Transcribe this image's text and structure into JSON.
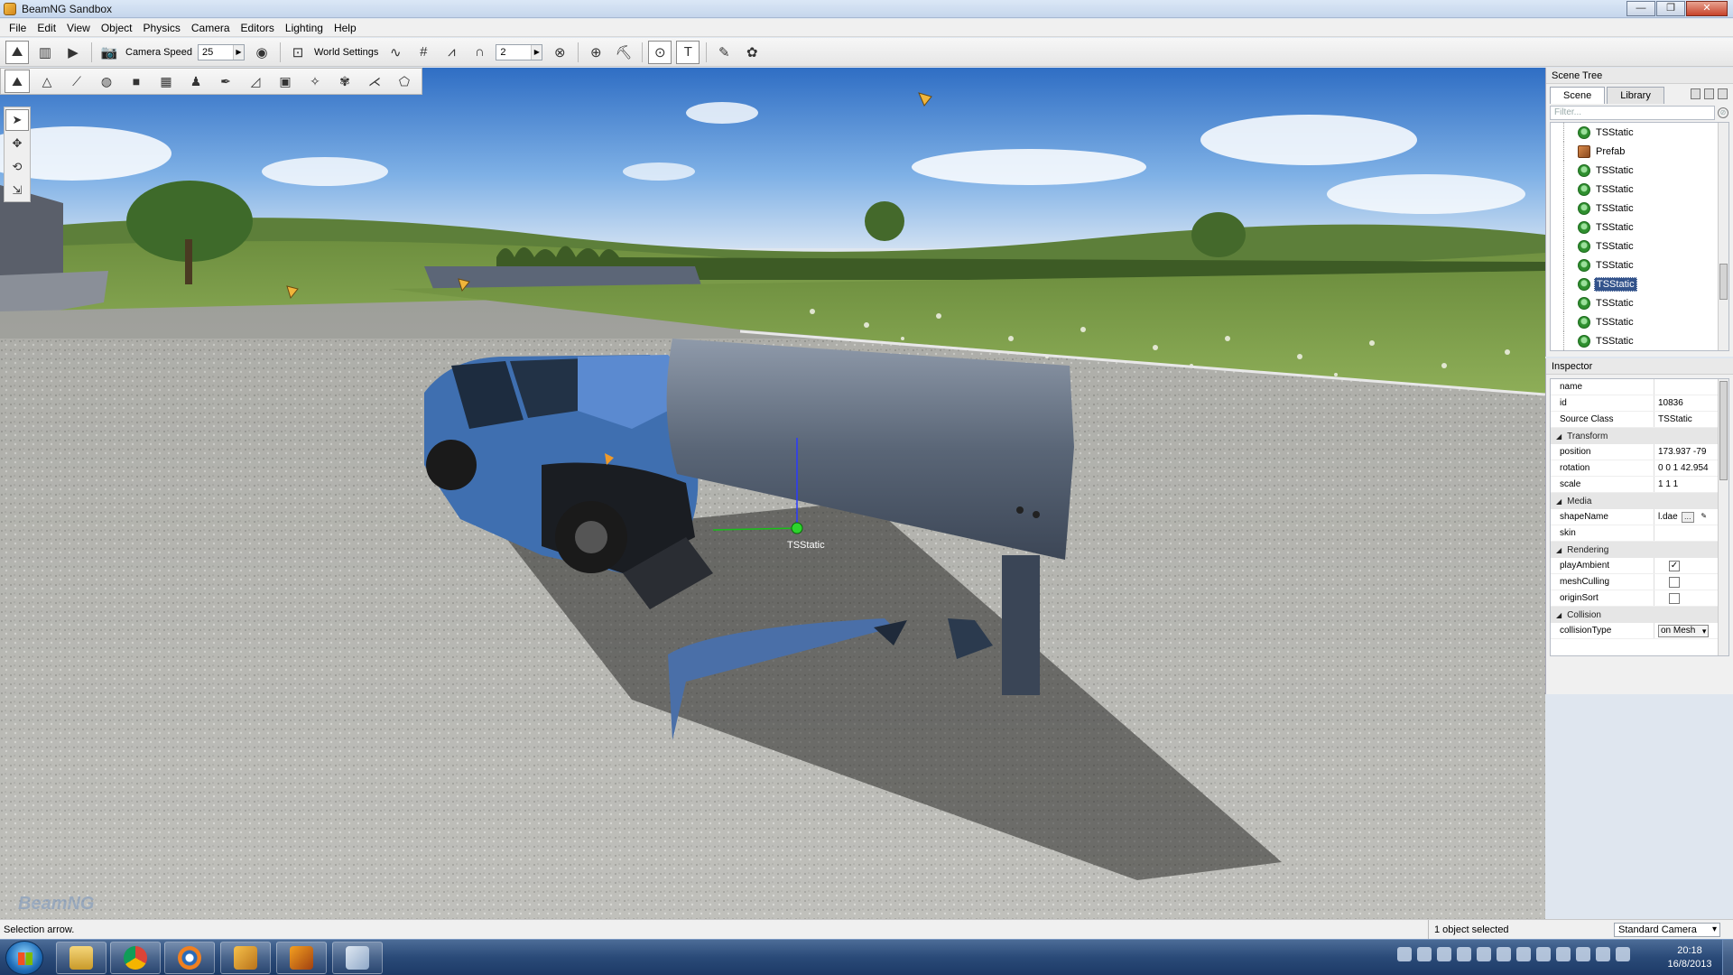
{
  "window": {
    "title": "BeamNG Sandbox",
    "controls": [
      "—",
      "❐",
      "✕"
    ]
  },
  "menubar": [
    "File",
    "Edit",
    "View",
    "Object",
    "Physics",
    "Camera",
    "Editors",
    "Lighting",
    "Help"
  ],
  "toolbar": {
    "camera_speed_label": "Camera Speed",
    "camera_speed_value": "25",
    "world_settings_label": "World Settings",
    "snap_value": "2"
  },
  "viewport": {
    "object_label": "TSStatic",
    "watermark": "BeamNG"
  },
  "scene_tree": {
    "title": "Scene Tree",
    "tabs": [
      "Scene",
      "Library"
    ],
    "filter_placeholder": "Filter...",
    "items": [
      {
        "label": "TSStatic",
        "type": "static"
      },
      {
        "label": "Prefab",
        "type": "prefab"
      },
      {
        "label": "TSStatic",
        "type": "static"
      },
      {
        "label": "TSStatic",
        "type": "static"
      },
      {
        "label": "TSStatic",
        "type": "static"
      },
      {
        "label": "TSStatic",
        "type": "static"
      },
      {
        "label": "TSStatic",
        "type": "static"
      },
      {
        "label": "TSStatic",
        "type": "static"
      },
      {
        "label": "TSStatic",
        "type": "static",
        "selected": true
      },
      {
        "label": "TSStatic",
        "type": "static"
      },
      {
        "label": "TSStatic",
        "type": "static"
      },
      {
        "label": "TSStatic",
        "type": "static"
      }
    ]
  },
  "inspector": {
    "title": "Inspector",
    "rows": {
      "name": {
        "key": "name",
        "value": ""
      },
      "id": {
        "key": "id",
        "value": "10836"
      },
      "source_class": {
        "key": "Source Class",
        "value": "TSStatic"
      },
      "position": {
        "key": "position",
        "value": "173.937 -79"
      },
      "rotation": {
        "key": "rotation",
        "value": "0 0 1 42.954"
      },
      "scale": {
        "key": "scale",
        "value": "1 1 1"
      },
      "shape_name": {
        "key": "shapeName",
        "value": "l.dae"
      },
      "skin": {
        "key": "skin",
        "value": ""
      },
      "play_ambient": {
        "key": "playAmbient",
        "checked": true
      },
      "mesh_culling": {
        "key": "meshCulling",
        "checked": false
      },
      "origin_sort": {
        "key": "originSort",
        "checked": false
      },
      "collision_type": {
        "key": "collisionType",
        "value": "on Mesh"
      }
    },
    "groups": {
      "transform": "Transform",
      "media": "Media",
      "rendering": "Rendering",
      "collision": "Collision"
    }
  },
  "statusbar": {
    "left": "Selection arrow.",
    "middle": "1 object selected",
    "camera_mode": "Standard Camera"
  },
  "taskbar": {
    "time": "20:18",
    "date": "16/8/2013",
    "apps": [
      "explorer",
      "chrome",
      "blender",
      "beamng",
      "hammer",
      "paint"
    ]
  },
  "colors": {
    "selection": "#33538b",
    "titlebar": "#c5d6ec",
    "taskbar": "#2a4a78"
  }
}
